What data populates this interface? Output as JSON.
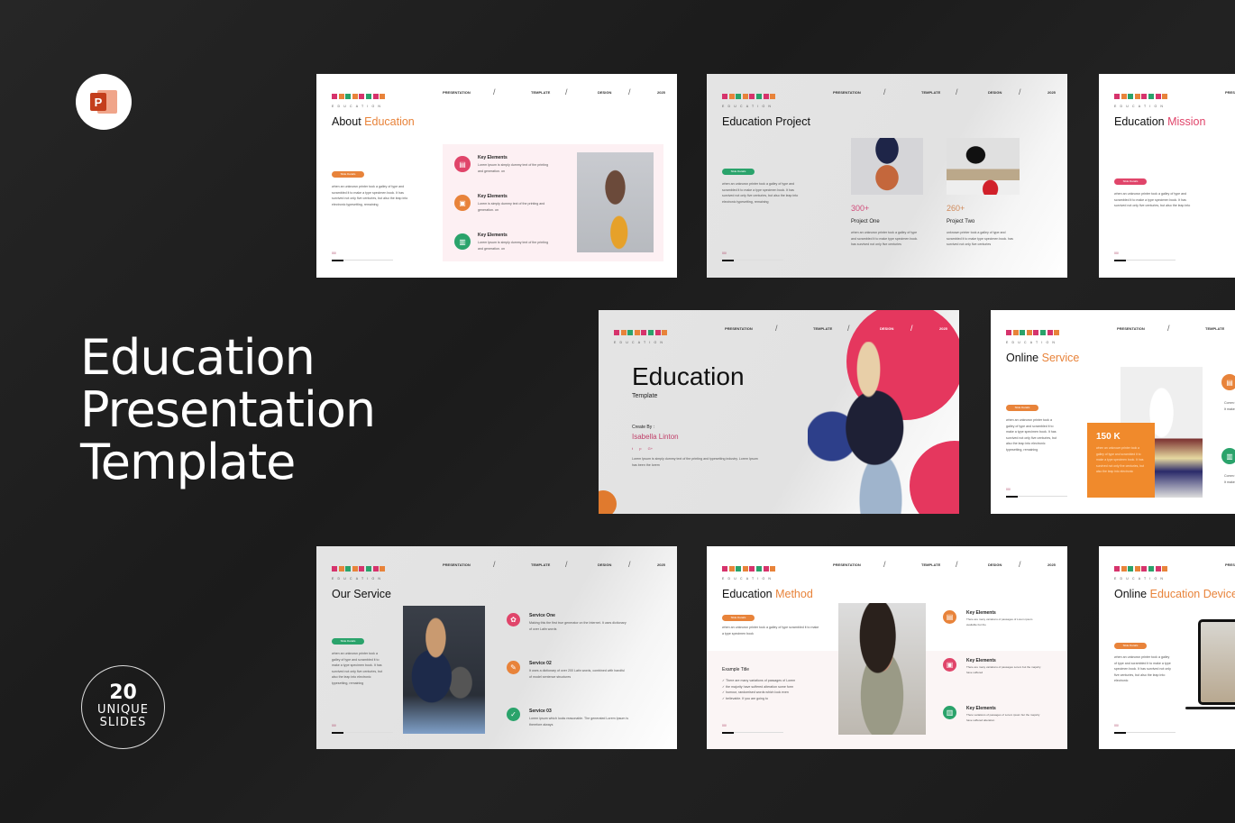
{
  "app_icon": {
    "letter": "P",
    "name": "powerpoint-icon"
  },
  "headline": {
    "line1": "Education",
    "line2": "Presentation",
    "line3": "Template"
  },
  "badge": {
    "number": "20",
    "line1": "UNIQUE",
    "line2": "SLIDES"
  },
  "colors": {
    "background": "#1e1e1e",
    "orange": "#e8833a",
    "pink": "#e0456a",
    "green": "#2aa36b"
  },
  "common": {
    "logo_text": "EDUCATION",
    "nav": [
      "PRESENTATION",
      "TEMPLATE",
      "DESIGN",
      "2025"
    ],
    "slash": "/",
    "pill": "Slide Details",
    "footer": "00/",
    "lorem": "when an unknown printer took a galley of type and scrambled it to make a type specimen book. It has survived not only five centuries, but also the leap into electronic typesetting, remaining"
  },
  "slides": {
    "about": {
      "title": "About",
      "title_accent": "Education",
      "items": [
        {
          "title": "Key Elements",
          "text": "Lorem Ipsum is simply dummy text of the printing and generation. on"
        },
        {
          "title": "Key Elements",
          "text": "Lorem is simply dummy text of the printing and generation. on"
        },
        {
          "title": "Key Elements",
          "text": "Lorem Ipsum is simply dummy text of the printing and generation. on"
        }
      ]
    },
    "project": {
      "title": "Education Project",
      "projects": [
        {
          "stat": "300+",
          "name": "Project One",
          "text": "when an unknown printer took a galley of type and scrambled it to make type specimen book. has survived not only five centuries"
        },
        {
          "stat": "260+",
          "name": "Project Two",
          "text": "unknown printer took a galley of type and scrambled it to make type specimen book. has survived not only five centuries"
        }
      ]
    },
    "mission": {
      "title": "Education",
      "title_accent": "Mission",
      "text": "when an unknown printer took a galley of type and scrambled it to make a type specimen book. It has survived not only five centuries, but also the leap into"
    },
    "cover": {
      "title": "Education",
      "subtitle": "Template",
      "created_label": "Create By :",
      "author": "Isabella Linton",
      "social": [
        "t",
        "p",
        "G+"
      ],
      "text": "Lorem Ipsum is simply dummy text of the printing and typesetting industry. Lorem Ipsum has been the lorem"
    },
    "online_service": {
      "title": "Online",
      "title_accent": "Service",
      "stat": "150 K",
      "stat_text": "when an unknown printer took a galley of type and scrambled it to make a type specimen book. It has survived not only five centuries, but also the leap into electronic",
      "items": [
        "Comm text. It makes",
        "Comm text. It makes"
      ]
    },
    "our_service": {
      "title": "Our Service",
      "items": [
        {
          "title": "Service One",
          "text": "Making this the first true generator on the Internet. It uses dictionary of over Latin words"
        },
        {
          "title": "Service 02",
          "text": "It uses a dictionary of over 200 Latin words, combined with handful of model sentence structures"
        },
        {
          "title": "Service 03",
          "text": "Lorem ipsum which looks reasonable. The generated Lorem Ipsum is therefore always"
        }
      ]
    },
    "method": {
      "title": "Education",
      "title_accent": "Method",
      "text": "when an unknown printer took a galley of type scrambled it to make a type specimen book",
      "example_title": "Example Title",
      "checks": [
        "There are many variations of passages of Lorem",
        "the majority have suffered alteration some form",
        "humour, randomised words which look even",
        "believable. If you are going to"
      ],
      "items": [
        {
          "title": "Key Elements",
          "text": "There are many variations of passages of Lorem ipsum available but the"
        },
        {
          "title": "Key Elements",
          "text": "There are many variations of passages Lorem but the majority have suffered"
        },
        {
          "title": "Key Elements",
          "text": "There variations of passages of Lorem ipsum but the majority have suffered alteration"
        }
      ]
    },
    "device": {
      "title": "Online",
      "title_accent": "Education Device",
      "text": "when an unknown printer took a galley of type and scrambled it to make a type specimen book. It has survived not only five centuries, but also the leap into electronic"
    }
  }
}
